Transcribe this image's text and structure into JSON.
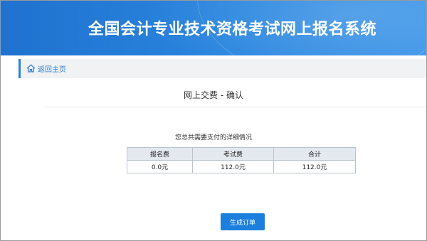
{
  "header": {
    "title": "全国会计专业技术资格考试网上报名系统"
  },
  "breadcrumb": {
    "home_label": "返回主页",
    "home_icon": "home-icon"
  },
  "main": {
    "heading": "网上交费 - 确认",
    "caption": "您总共需要支付的详细情况",
    "table": {
      "headers": [
        "报名费",
        "考试费",
        "合计"
      ],
      "rows": [
        [
          "0.0元",
          "112.0元",
          "112.0元"
        ]
      ]
    },
    "submit_label": "生成订单"
  },
  "colors": {
    "banner": "#2a86df",
    "accent": "#2a7bd0",
    "button": "#1c7fdc",
    "table_header": "#e4e9f0"
  }
}
